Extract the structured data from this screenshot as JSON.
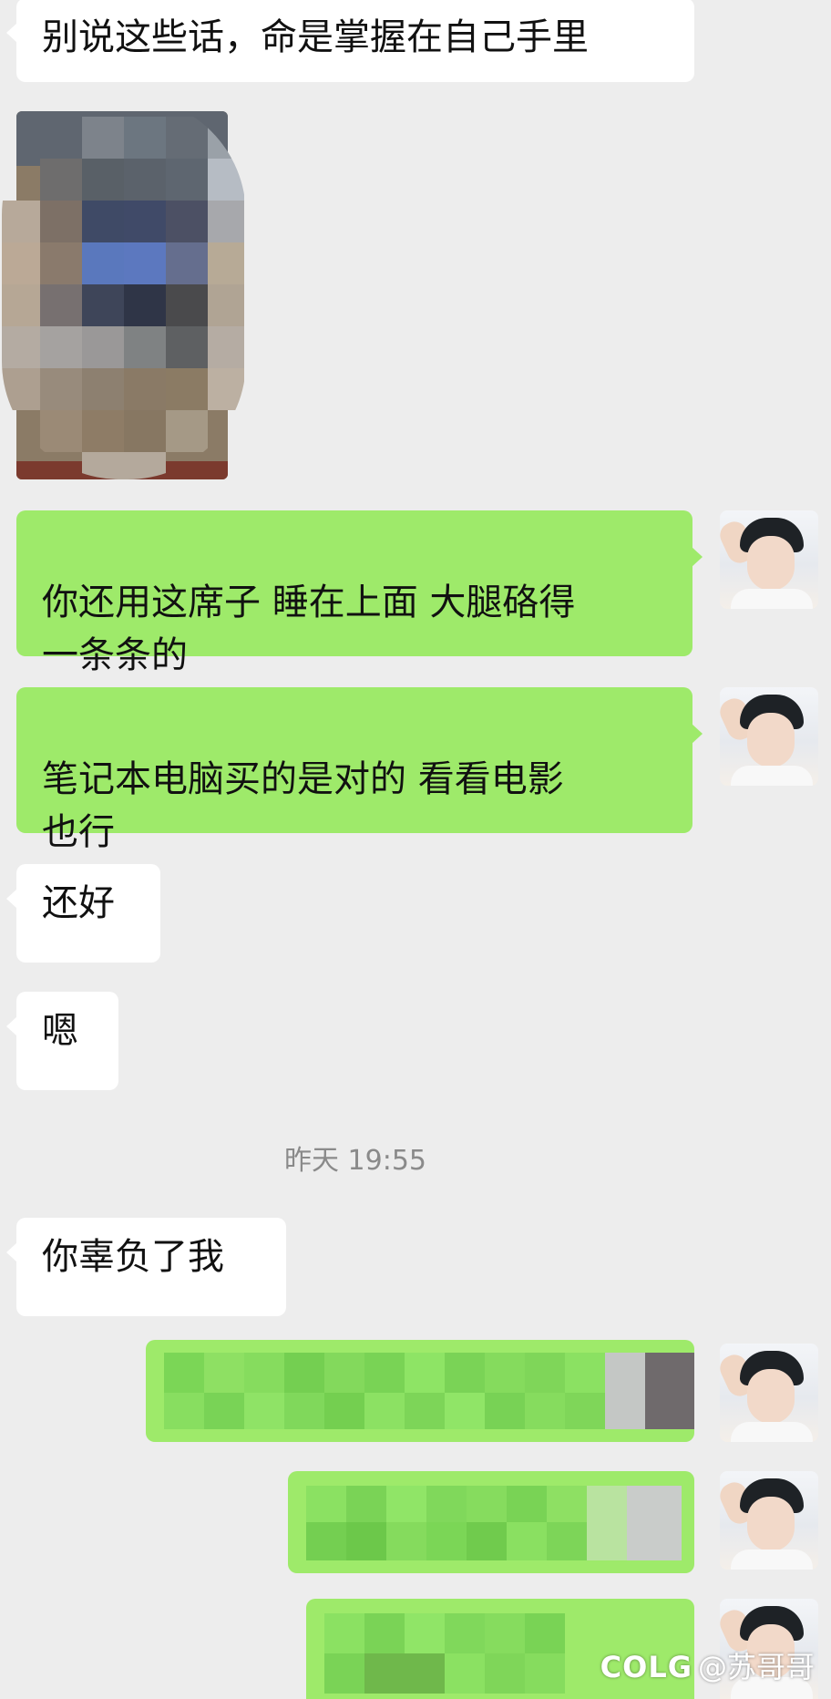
{
  "messages": [
    {
      "side": "left",
      "text": "别说这些话，命是掌握在自己手里"
    },
    {
      "side": "right",
      "text": "你还用这席子 睡在上面 大腿硌得\n一条条的"
    },
    {
      "side": "right",
      "text": "笔记本电脑买的是对的 看看电影\n也行"
    },
    {
      "side": "left",
      "text": "还好"
    },
    {
      "side": "left",
      "text": "嗯"
    },
    {
      "side": "left",
      "text": "你辜负了我"
    }
  ],
  "timestamp": "昨天 19:55",
  "watermark": {
    "logo": "COLG",
    "handle": "@苏哥哥"
  },
  "colors": {
    "background": "#ededed",
    "left_bubble": "#ffffff",
    "right_bubble": "#9eea6a"
  },
  "icons": {
    "avatar": "user-avatar-photo",
    "blurred": "pixelated-redaction"
  }
}
